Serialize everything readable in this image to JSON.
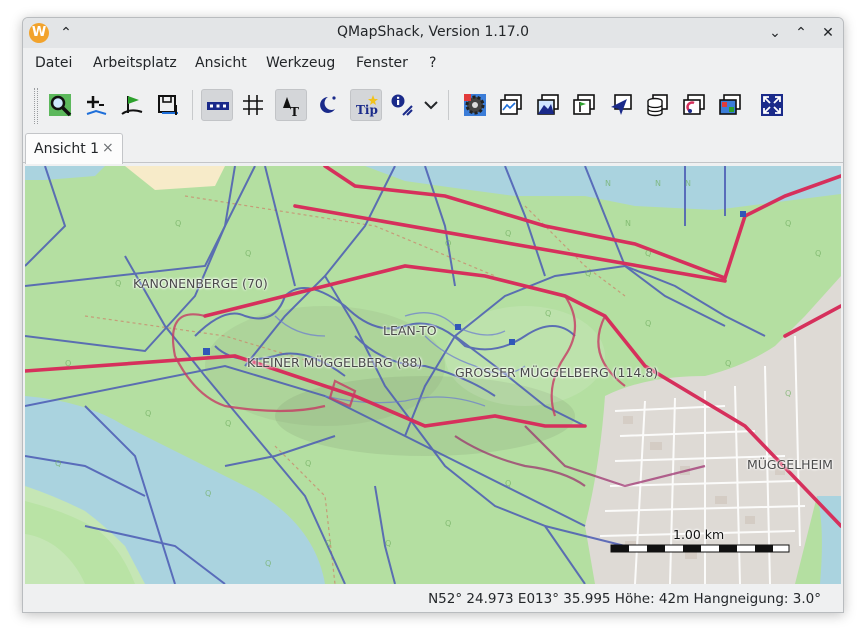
{
  "window": {
    "title": "QMapShack, Version 1.17.0",
    "app_icon_glyph": "W",
    "keep_above_glyph": "⌃",
    "minimize_glyph": "⌄",
    "maximize_glyph": "⌃",
    "close_glyph": "✕"
  },
  "menu": {
    "items": [
      "Datei",
      "Arbeitsplatz",
      "Ansicht",
      "Werkzeug",
      "Fenster",
      "?"
    ]
  },
  "toolbar": {
    "buttons": [
      {
        "icon": "search-map-icon",
        "active": false
      },
      {
        "icon": "add-waypoint-icon",
        "active": false
      },
      {
        "icon": "route-flag-icon",
        "active": false
      },
      {
        "icon": "save-map-icon",
        "active": false
      },
      {
        "icon": "scale-bar-icon",
        "active": true
      },
      {
        "icon": "grid-icon",
        "active": false
      },
      {
        "icon": "text-on-map-icon",
        "active": true
      },
      {
        "icon": "night-mode-icon",
        "active": false
      },
      {
        "icon": "tooltip-icon",
        "active": true
      },
      {
        "icon": "info-track-icon",
        "active": false
      },
      {
        "icon": "more-dropdown-icon",
        "active": false
      },
      {
        "icon": "settings-gear-icon",
        "active": false
      },
      {
        "icon": "map-view-icon",
        "active": false
      },
      {
        "icon": "dem-view-icon",
        "active": false
      },
      {
        "icon": "gis-view-icon",
        "active": false
      },
      {
        "icon": "routing-view-icon",
        "active": false
      },
      {
        "icon": "database-view-icon",
        "active": false
      },
      {
        "icon": "realtime-view-icon",
        "active": false
      },
      {
        "icon": "tile-view-icon",
        "active": false
      },
      {
        "icon": "fullscreen-icon",
        "active": false
      }
    ],
    "tip_label": "Tip"
  },
  "tabs": [
    {
      "label": "Ansicht 1",
      "close_glyph": "×"
    }
  ],
  "map": {
    "labels": {
      "kanonenberge": "KANONENBERGE (70)",
      "lean_to": "LEAN-TO",
      "kleiner": "KLEINER MÜGGELBERG (88)",
      "grosser": "GROSSER MÜGGELBERG (114.8)",
      "mueggelheim": "MÜGGELHEIM"
    },
    "scale_label": "1.00 km",
    "colors": {
      "forest": "#b9e3a5",
      "water": "#aad3df",
      "road_primary": "#d6305c",
      "path": "#4b5bb4",
      "residential": "#dedad5"
    }
  },
  "status": {
    "text": "N52° 24.973 E013° 35.995  Höhe: 42m  Hangneigung: 3.0°"
  }
}
